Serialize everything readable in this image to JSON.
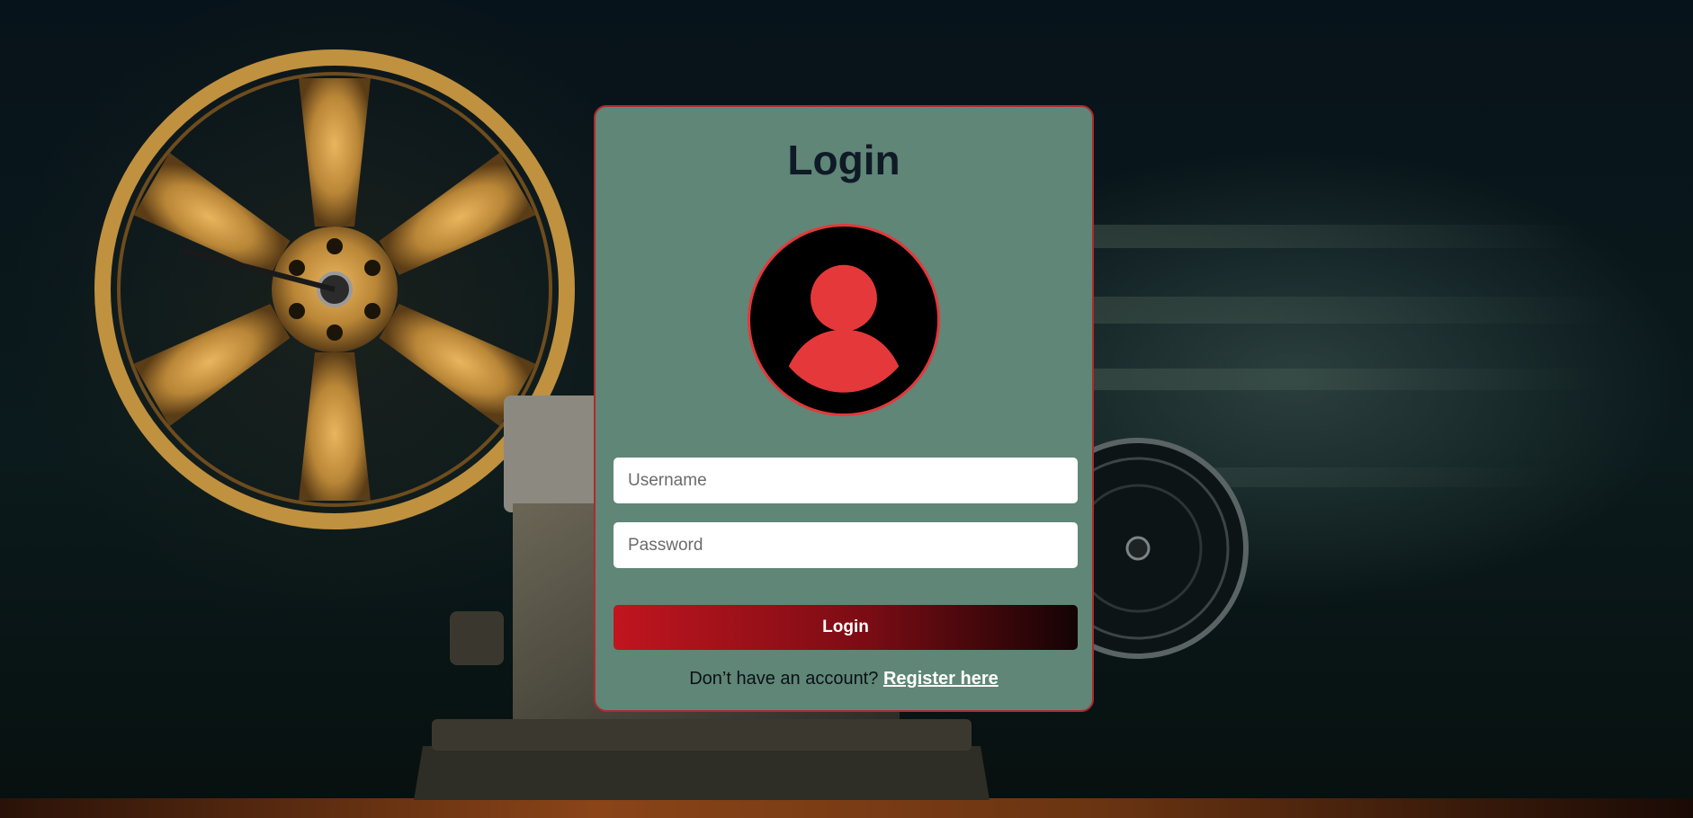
{
  "login_card": {
    "title": "Login",
    "avatar_icon": "user-icon",
    "username_placeholder": "Username",
    "username_value": "",
    "password_placeholder": "Password",
    "password_value": "",
    "submit_label": "Login",
    "register_prompt": "Don’t have an account?",
    "register_link_label": "Register here"
  },
  "colors": {
    "card_background": "#5f8677",
    "card_border": "#b3282d",
    "title_text": "#101a26",
    "avatar_background": "#000000",
    "avatar_accent": "#e5383b",
    "button_gradient_start": "#c1151f",
    "button_gradient_end": "#140304",
    "link_text": "#ffffff"
  }
}
